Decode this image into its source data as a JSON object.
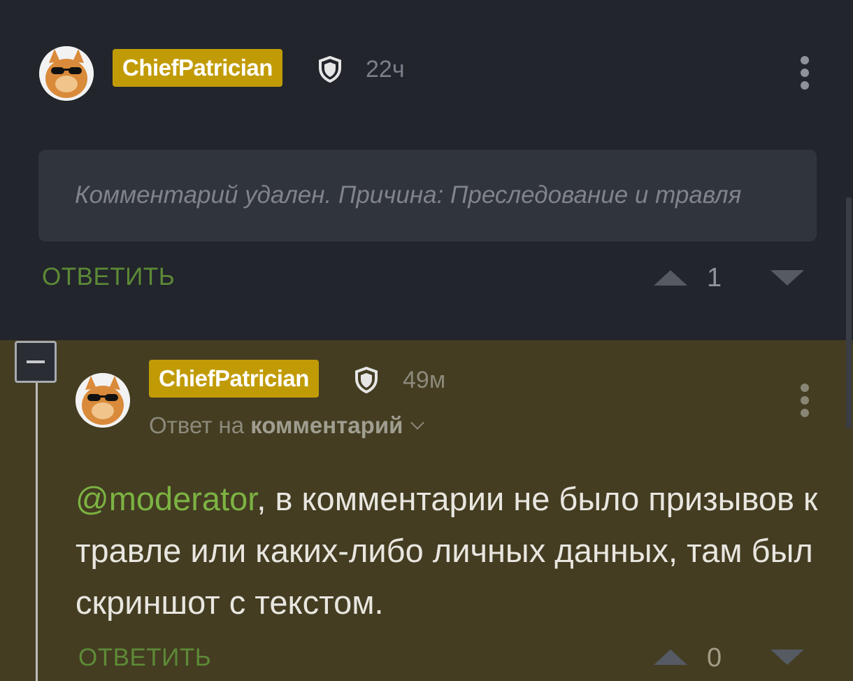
{
  "comments": [
    {
      "username": "ChiefPatrician",
      "time": "22ч",
      "deleted_text": "Комментарий удален. Причина: Преследование и травля",
      "reply_label": "ОТВЕТИТЬ",
      "score": "1"
    },
    {
      "username": "ChiefPatrician",
      "time": "49м",
      "reply_to_prefix": "Ответ на",
      "reply_to_target": "комментарий",
      "mention": "@moderator",
      "body_text": ", в комментарии не было призывов к травле или каких-либо личных данных, там был скриншот с текстом.",
      "reply_label": "ОТВЕТИТЬ",
      "score": "0"
    }
  ],
  "colors": {
    "background": "#22252c",
    "nested_background": "#443d22",
    "badge": "#c19b06",
    "reply_link": "#5d8a36",
    "mention": "#7cb342"
  },
  "icons": [
    "avatar-cat-sunglasses",
    "shield-icon",
    "more-vert-icon",
    "vote-up-icon",
    "vote-down-icon",
    "collapse-minus-icon",
    "chevron-down-icon"
  ]
}
